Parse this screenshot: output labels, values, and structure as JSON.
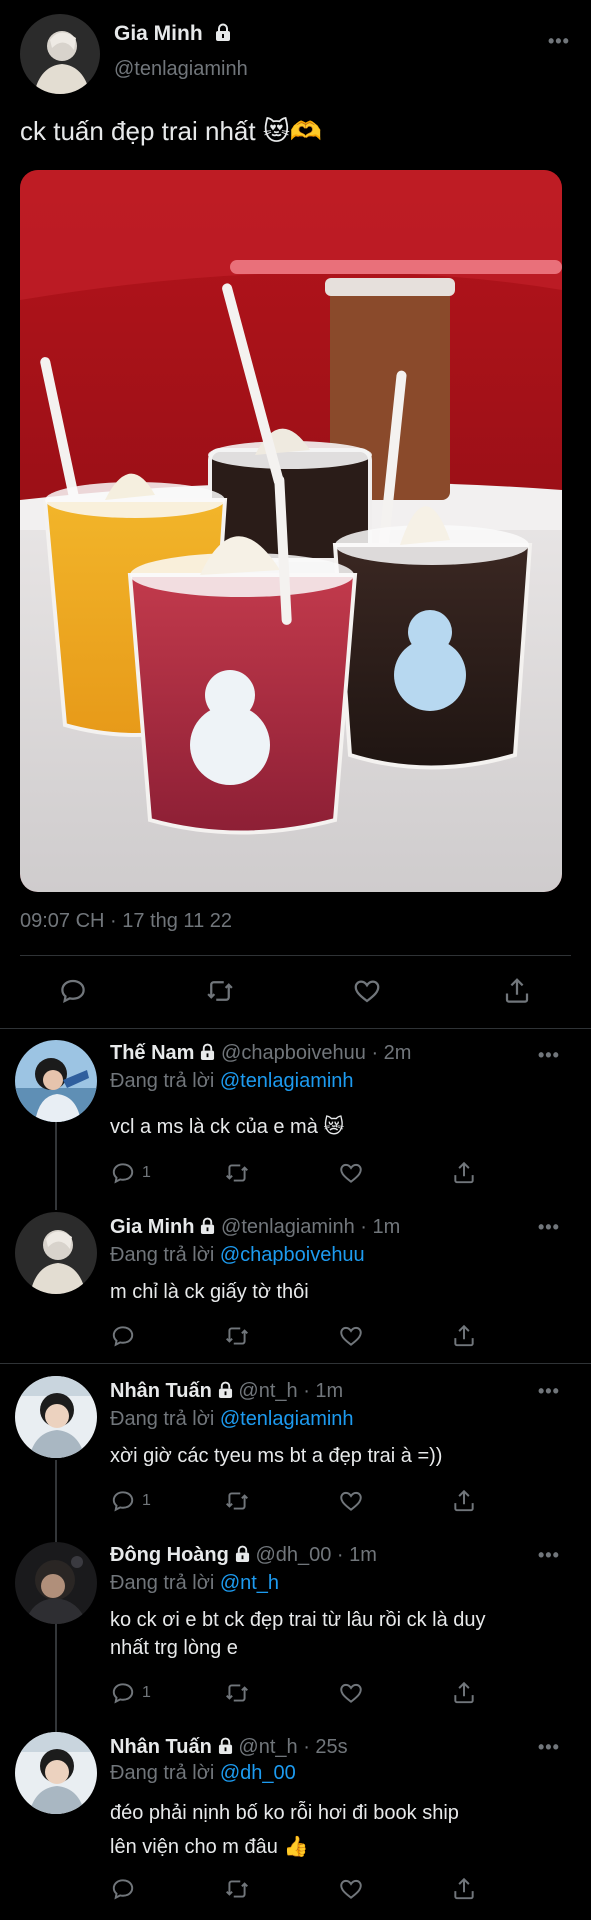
{
  "main_tweet": {
    "author_name": "Gia Minh",
    "author_handle": "@tenlagiaminh",
    "text": "ck tuấn đẹp trai nhất 😻🫶",
    "timestamp": "09:07 CH · 17 thg 11 22"
  },
  "replies": [
    {
      "name": "Thế Nam",
      "handle": "@chapboivehuu · 2m",
      "replying_prefix": "Đang trả lời ",
      "replying_to": "@tenlagiaminh",
      "lines": [
        "vcl a ms là ck của e mà 😿"
      ],
      "reply_count": "1"
    },
    {
      "name": "Gia Minh",
      "handle": "@tenlagiaminh · 1m",
      "replying_prefix": "Đang trả lời ",
      "replying_to": "@chapboivehuu",
      "lines": [
        "m chỉ là ck giấy tờ thôi"
      ],
      "reply_count": ""
    },
    {
      "name": "Nhân Tuấn",
      "handle": "@nt_h · 1m",
      "replying_prefix": "Đang trả lời ",
      "replying_to": "@tenlagiaminh",
      "lines": [
        "xời giờ các tyeu ms bt a đẹp trai à =))"
      ],
      "reply_count": "1"
    },
    {
      "name": "Đông Hoàng",
      "handle": "@dh_00 · 1m",
      "replying_prefix": "Đang trả lời ",
      "replying_to": "@nt_h",
      "lines": [
        "ko ck ơi e bt ck đẹp trai từ lâu rồi ck là duy",
        "nhất trg lòng e"
      ],
      "reply_count": "1"
    },
    {
      "name": "Nhân Tuấn",
      "handle": "@nt_h · 25s",
      "replying_prefix": "Đang trả lời ",
      "replying_to": "@dh_00",
      "lines": [
        "đéo phải nịnh bố ko rỗi hơi đi book ship",
        "lên viện cho m đâu 👍"
      ],
      "reply_count": ""
    }
  ],
  "colors": {
    "background": "#000000",
    "text": "#e7e9ea",
    "muted": "#71767b",
    "link": "#1d9bf0",
    "divider": "#2f3336"
  },
  "icons": [
    "lock-icon",
    "more-icon",
    "reply-icon",
    "retweet-icon",
    "like-icon",
    "share-icon"
  ]
}
